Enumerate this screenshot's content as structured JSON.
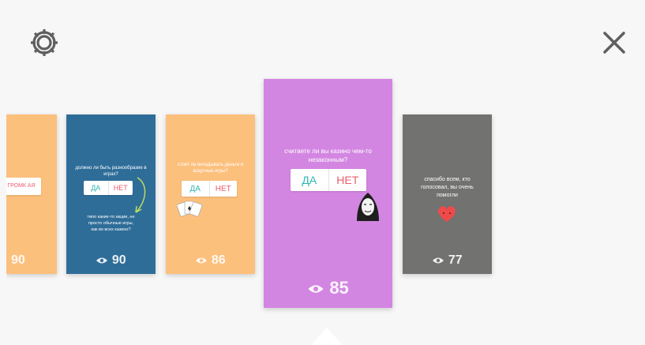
{
  "header": {
    "settings_icon": "gear-icon",
    "close_icon": "close-icon"
  },
  "cards": [
    {
      "color": "#fcc07d",
      "question": "",
      "poll_yes": "",
      "poll_no": "ГРОМК АЯ",
      "views": "90"
    },
    {
      "color": "#2f6d99",
      "question": "должно ли быть разнообразие в играх?",
      "poll_yes": "ДА",
      "poll_no": "НЕТ",
      "answer": "типо какие-то акции, не просто обычные игры, как во всех казино?",
      "views": "90"
    },
    {
      "color": "#fcc07d",
      "question": "стоит ли вкладывать деньги в азартные игры?",
      "poll_yes": "ДА",
      "poll_no": "НЕТ",
      "views": "86"
    },
    {
      "color": "#d386e1",
      "question": "считаете ли вы казино чем-то незаконным?",
      "poll_yes": "ДА",
      "poll_no": "НЕТ",
      "views": "85"
    },
    {
      "color": "#727270",
      "question": "спасибо всем, кто голосовал, вы очень помогли",
      "views": "77"
    }
  ],
  "colors": {
    "poll_yes": "#31b5b0",
    "poll_no": "#ee5c6d",
    "background": "#f7f7f7"
  }
}
